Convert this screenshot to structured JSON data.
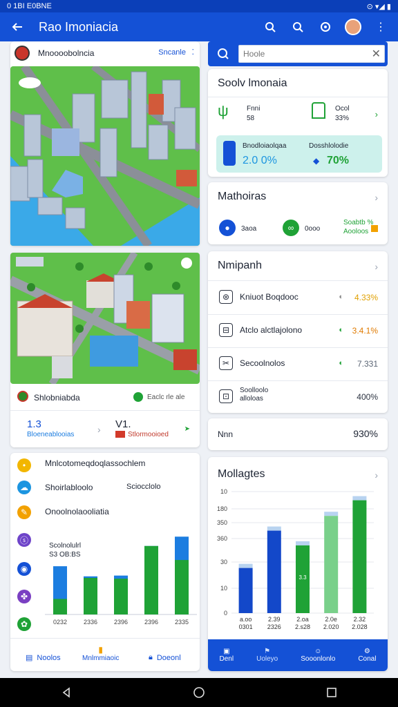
{
  "status": {
    "left": "0 1BI E0BNE",
    "right": "⊙ ▾◢ ▮"
  },
  "appbar": {
    "title": "Rao Imoniacia"
  },
  "left_card": {
    "title": "Mnoooobolncia",
    "action": "Sncanle"
  },
  "district": {
    "name": "Shlobniabda",
    "badge": "Eaclc rle ale",
    "stat1_value": "1.3",
    "stat1_label": "Bloeneablooias",
    "stat2_value": "V1.",
    "stat2_label": "Stlormooioed"
  },
  "list_card": {
    "items": [
      {
        "label": "Mnlcotomeqdoqlassochlem",
        "value": ""
      },
      {
        "label": "Shoirlabloolo",
        "value": "Sciocclolo"
      },
      {
        "label": "Onoolnolaooliatia",
        "value": ""
      }
    ],
    "chart_note": "Scolnolulrl\nS3 OB:BS",
    "x_labels": [
      "0232",
      "2336",
      "2396",
      "2396",
      "2335"
    ],
    "tabs": [
      "Noolos",
      "Mnlmmiaoic",
      "Doeonl"
    ]
  },
  "search": {
    "placeholder": "Hoole"
  },
  "summary": {
    "title": "Soolv lmonaia",
    "item1_label": "Fnni",
    "item1_value": "58",
    "item2_label": "Ocol",
    "item2_value": "33%",
    "banner_left_label": "Bnodloiaolqaa",
    "banner_left_value": "2.0 0%",
    "banner_right_label": "Dosshlolodie",
    "banner_right_value": "70%"
  },
  "mathotas": {
    "title": "Mathoiras",
    "a_label": "3aoa",
    "b_label": "0ooo",
    "c_label": "Soabtb %\nAooloos"
  },
  "metrics": {
    "title": "Nmipanh",
    "rows": [
      {
        "label": "Kniuot Boqdooc",
        "value": "4.33%",
        "color": "#e0a000"
      },
      {
        "label": "Atclo alctlajolono",
        "value": "3.4.1%",
        "color": "#e07a00"
      },
      {
        "label": "Secoolnolos",
        "value": "7.331",
        "color": "#5a6474"
      },
      {
        "label": "Soolloolo\nalloloas",
        "value": "400%",
        "color": "#2b3240"
      }
    ]
  },
  "mini_row": {
    "label": "Nnn",
    "value": "930%"
  },
  "chart_card": {
    "title": "Mollagtes",
    "tabs": [
      "Denl",
      "Uoleyo",
      "Sooonlonlo",
      "Conal"
    ]
  },
  "chart_data": [
    {
      "type": "bar",
      "title": "",
      "categories": [
        "0332",
        "2336",
        "2336",
        "2335",
        "2336"
      ],
      "series": [
        {
          "values": [
            62,
            49,
            50,
            88,
            100
          ],
          "color": "#1c7de0"
        },
        {
          "values": [
            20,
            47,
            46,
            88,
            70
          ],
          "color": "#1fa236"
        }
      ],
      "ylim": [
        0,
        110
      ]
    },
    {
      "type": "bar",
      "title": "",
      "y_ticks": [
        "0",
        "10",
        "30",
        "360",
        "350",
        "180",
        "10"
      ],
      "categories": [
        "a.oo\n0301",
        "2.39\n2326",
        "2.oa\n2.s28",
        "2.0e\n2.020",
        "2.32\n2.028"
      ],
      "values": [
        52,
        95,
        78,
        112,
        130
      ],
      "colors": [
        "#1348c9",
        "#1348c9",
        "#1fa236",
        "#79d08a",
        "#1fa236"
      ],
      "bar_note": "3.3"
    }
  ]
}
